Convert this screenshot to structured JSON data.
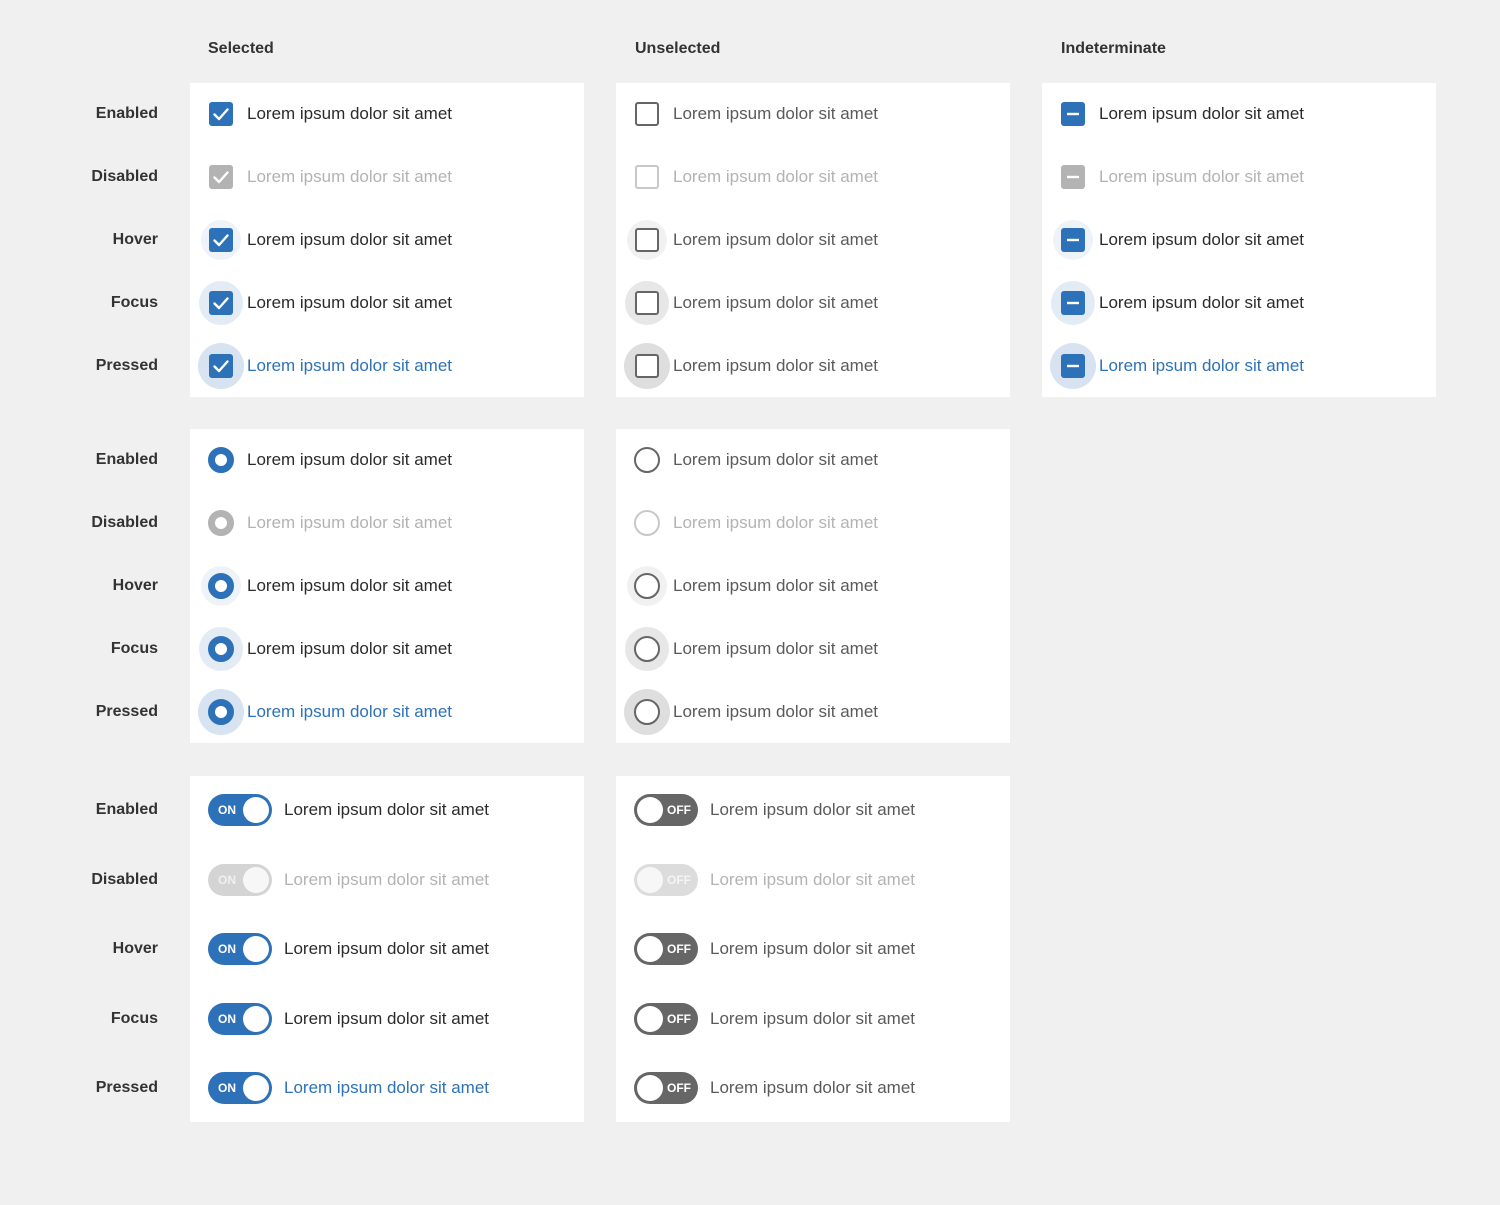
{
  "columns": {
    "selected": "Selected",
    "unselected": "Unselected",
    "indeterminate": "Indeterminate"
  },
  "states": [
    "Enabled",
    "Disabled",
    "Hover",
    "Focus",
    "Pressed"
  ],
  "item_label": "Lorem ipsum dolor sit amet",
  "toggle": {
    "on": "ON",
    "off": "OFF"
  },
  "colors": {
    "page_bg": "#f0f0f0",
    "panel_bg": "#ffffff",
    "accent": "#2d72b8",
    "disabled": "#b3b3b3",
    "unselected_border": "#666666",
    "toggle_off": "#666666"
  },
  "icons": {
    "check": "check-icon",
    "minus": "minus-icon",
    "radio_dot": "radio-dot-icon"
  }
}
